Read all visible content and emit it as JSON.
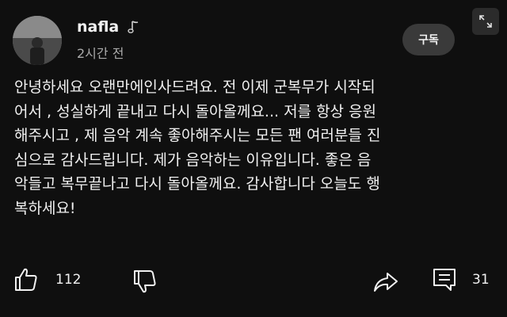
{
  "channel": {
    "name": "nafla",
    "badge_icon": "music-note-icon",
    "timestamp": "2시간 전"
  },
  "header": {
    "subscribe_label": "구독",
    "expand_icon": "expand-icon"
  },
  "post": {
    "lines": [
      "안녕하세요 오랜만에인사드려요. 전 이제 군복무가 시작되",
      "어서 , 성실하게 끝내고 다시 돌아올께요... 저를 항상 응원",
      "해주시고 , 제 음악 계속 좋아해주시는 모든 팬 여러분들 진",
      "심으로 감사드립니다. 제가 음악하는 이유입니다. 좋은 음",
      "악들고 복무끝나고 다시 돌아올께요. 감사합니다 오늘도 행",
      "복하세요!"
    ]
  },
  "actions": {
    "like_icon": "thumbs-up-icon",
    "like_count": "112",
    "dislike_icon": "thumbs-down-icon",
    "share_icon": "share-icon",
    "comment_icon": "comment-icon",
    "comment_count": "31"
  },
  "colors": {
    "background": "#0f0f0f",
    "text": "#f1f1f1",
    "secondary_text": "#aaaaaa",
    "button_bg": "#3a3a3a"
  }
}
